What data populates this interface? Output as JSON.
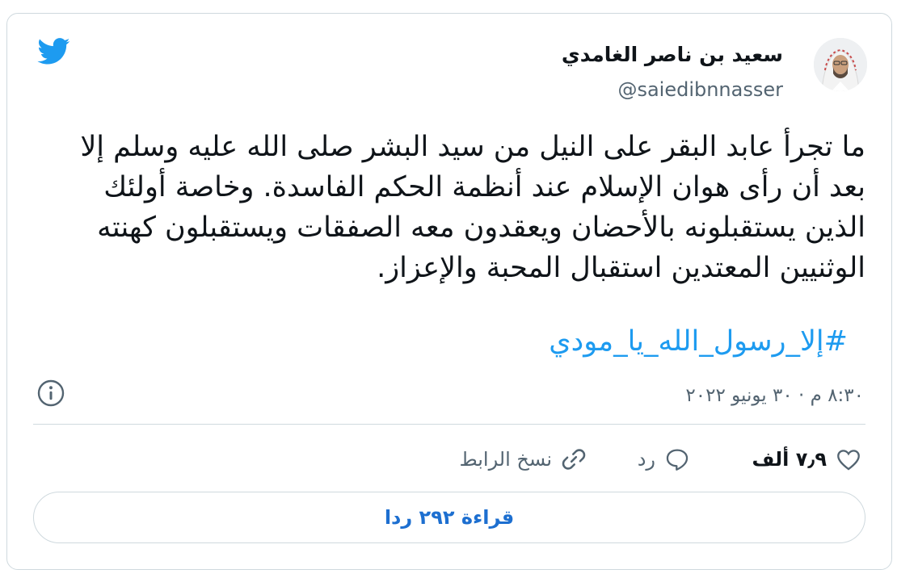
{
  "author": {
    "name": "سعيد بن ناصر الغامدي",
    "handle": "@saiedibnnasser"
  },
  "tweet": {
    "text": "ما تجرأ عابد البقر على النيل من سيد البشر صلى الله عليه وسلم إلا بعد أن رأى هوان الإسلام عند أنظمة الحكم الفاسدة. وخاصة أولئك الذين يستقبلونه بالأحضان ويعقدون معه الصفقات ويستقبلون كهنته الوثنيين المعتدين استقبال المحبة والإعزاز.",
    "hashtag": "#إلا_رسول_الله_يا_مودي",
    "timestamp": "٨:٣٠ م · ٣٠ يونيو ٢٠٢٢"
  },
  "actions": {
    "likes": "٧٫٩ ألف",
    "reply_label": "رد",
    "copy_link_label": "نسخ الرابط",
    "read_replies_label": "قراءة ٢٩٢ ردا"
  },
  "icons": {
    "brand": "twitter-bird-icon",
    "info": "info-icon",
    "like": "heart-icon",
    "reply": "speech-bubble-icon",
    "copy": "link-icon"
  },
  "colors": {
    "brand": "#1d9bf0",
    "link_button": "#1d6fd0",
    "muted": "#536471",
    "border": "#cfd9de"
  }
}
